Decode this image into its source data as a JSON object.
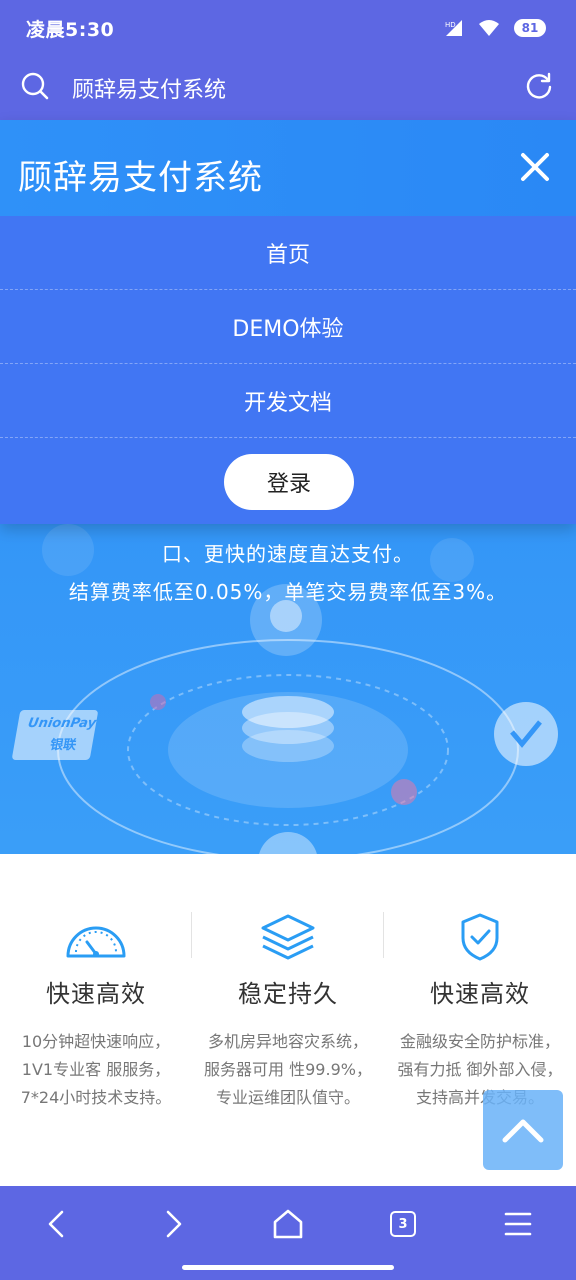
{
  "status_bar": {
    "time": "凌晨5:30",
    "hd_label": "HD",
    "battery": "81"
  },
  "browser": {
    "url_text": "顾辞易支付系统"
  },
  "hero": {
    "line1": "口、更快的速度直达支付。",
    "line2": "结算费率低至0.05%，单笔交易费率低至3%。",
    "unionpay_label": "UnionPay",
    "unionpay_cn": "银联"
  },
  "menu": {
    "title": "顾辞易支付系统",
    "items": [
      {
        "label": "首页"
      },
      {
        "label": "DEMO体验"
      },
      {
        "label": "开发文档"
      }
    ],
    "login_label": "登录"
  },
  "features": [
    {
      "icon": "speedometer-icon",
      "title": "快速高效",
      "desc": "10分钟超快速响应，1V1专业客 服服务，7*24小时技术支持。"
    },
    {
      "icon": "layers-icon",
      "title": "稳定持久",
      "desc": "多机房异地容灾系统，服务器可用 性99.9%，专业运维团队值守。"
    },
    {
      "icon": "shield-check-icon",
      "title": "快速高效",
      "desc": "金融级安全防护标准，强有力抵 御外部入侵，支持高并发交易。"
    }
  ],
  "bottom_nav": {
    "tab_count": "3"
  },
  "colors": {
    "bar": "#5d67e3",
    "menu": "#4176f3",
    "hero": "#3496f7",
    "accent": "#2a9df4"
  }
}
